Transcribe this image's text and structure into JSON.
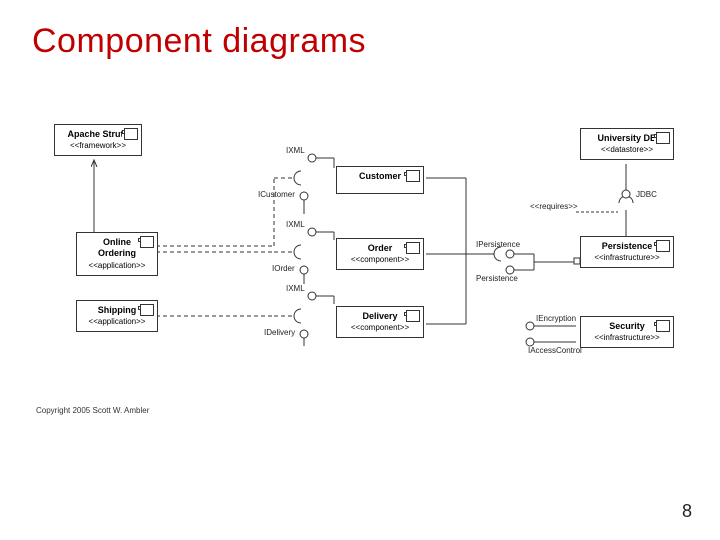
{
  "slide": {
    "title": "Component diagrams",
    "page_number": "8"
  },
  "copyright": "Copyright 2005 Scott W. Ambler",
  "components": {
    "apache_struts": {
      "name": "Apache Struts",
      "stereotype": "<<framework>>"
    },
    "online_ordering": {
      "name": "Online Ordering",
      "stereotype": "<<application>>"
    },
    "shipping": {
      "name": "Shipping",
      "stereotype": "<<application>>"
    },
    "customer": {
      "name": "Customer",
      "stereotype": ""
    },
    "order": {
      "name": "Order",
      "stereotype": "<<component>>"
    },
    "delivery": {
      "name": "Delivery",
      "stereotype": "<<component>>"
    },
    "university_db": {
      "name": "University DB",
      "stereotype": "<<datastore>>"
    },
    "persistence": {
      "name": "Persistence",
      "stereotype": "<<infrastructure>>"
    },
    "security": {
      "name": "Security",
      "stereotype": "<<infrastructure>>"
    }
  },
  "interfaces": {
    "ixml1": "IXML",
    "icustomer": "ICustomer",
    "ixml2": "IXML",
    "iorder": "IOrder",
    "ixml3": "IXML",
    "idelivery": "IDelivery",
    "ipersistence": "IPersistence",
    "persistence_port": "Persistence",
    "jdbc": "JDBC",
    "requires": "<<requires>>",
    "iencryption": "IEncryption",
    "iaccesscontrol": "IAccessControl"
  }
}
